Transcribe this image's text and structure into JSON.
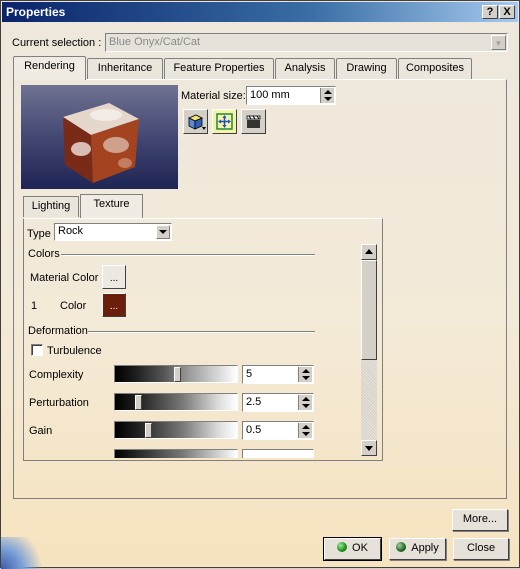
{
  "window": {
    "title": "Properties",
    "help_glyph": "?",
    "close_glyph": "X"
  },
  "current_selection": {
    "label": "Current selection :",
    "value": "Blue Onyx/Cat/Cat"
  },
  "tabs": [
    {
      "label": "Rendering",
      "active": true
    },
    {
      "label": "Inheritance"
    },
    {
      "label": "Feature Properties"
    },
    {
      "label": "Analysis"
    },
    {
      "label": "Drawing"
    },
    {
      "label": "Composites"
    }
  ],
  "rendering": {
    "material_size_label": "Material size:",
    "material_size_value": "100 mm",
    "icon_buttons": [
      "cube-mapping-icon",
      "fit-mapping-icon",
      "clapper-icon"
    ],
    "subtabs": [
      {
        "label": "Lighting"
      },
      {
        "label": "Texture",
        "active": true
      }
    ],
    "texture": {
      "type_label": "Type",
      "type_value": "Rock",
      "colors_group": "Colors",
      "material_color_label": "Material Color",
      "material_color_button": "...",
      "color_index": "1",
      "color_label": "Color",
      "color_swatch": "#6b1e0a",
      "color_button": "...",
      "deformation_group": "Deformation",
      "turbulence_label": "Turbulence",
      "turbulence_checked": false,
      "sliders": [
        {
          "label": "Complexity",
          "value": "5",
          "level": 0.5
        },
        {
          "label": "Perturbation",
          "value": "2.5",
          "level": 0.18
        },
        {
          "label": "Gain",
          "value": "0.5",
          "level": 0.26
        }
      ]
    }
  },
  "footer": {
    "more_label": "More...",
    "ok_label": "OK",
    "apply_label": "Apply",
    "close_label": "Close"
  },
  "colors": {
    "title_bar": "#0a246a",
    "ok_led": "#1f9a1f",
    "apply_led": "#2b6e2b"
  }
}
